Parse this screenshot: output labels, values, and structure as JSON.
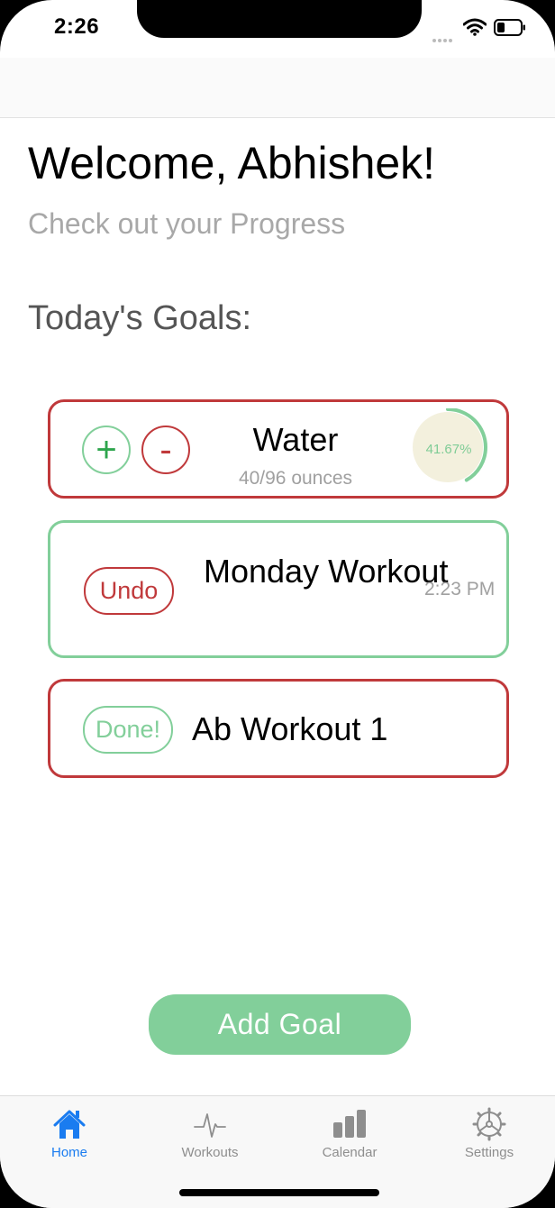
{
  "status_bar": {
    "time": "2:26",
    "icons": [
      "signal-icon",
      "wifi-icon",
      "battery-icon"
    ]
  },
  "header": {
    "welcome": "Welcome, Abhishek!",
    "subtitle": "Check out your Progress"
  },
  "goals": {
    "heading": "Today's Goals:",
    "water": {
      "title": "Water",
      "amount": "40/96 ounces",
      "plus_label": "+",
      "minus_label": "-",
      "progress_label": "41.67%",
      "progress_fraction": 0.4167
    },
    "monday_workout": {
      "title": "Monday Workout",
      "action_label": "Undo",
      "time": "2:23 PM"
    },
    "ab_workout": {
      "title": "Ab Workout 1",
      "action_label": "Done!"
    }
  },
  "add_goal_label": "Add Goal",
  "tab_bar": {
    "active": "Home",
    "items": [
      {
        "label": "Home",
        "icon": "home-icon"
      },
      {
        "label": "Workouts",
        "icon": "heartbeat-icon"
      },
      {
        "label": "Calendar",
        "icon": "bar-chart-icon"
      },
      {
        "label": "Settings",
        "icon": "gear-icon"
      }
    ]
  },
  "colors": {
    "green": "#82cf9a",
    "red": "#c0393b",
    "blue": "#1a7cf0",
    "gray": "#a8a8a8"
  }
}
